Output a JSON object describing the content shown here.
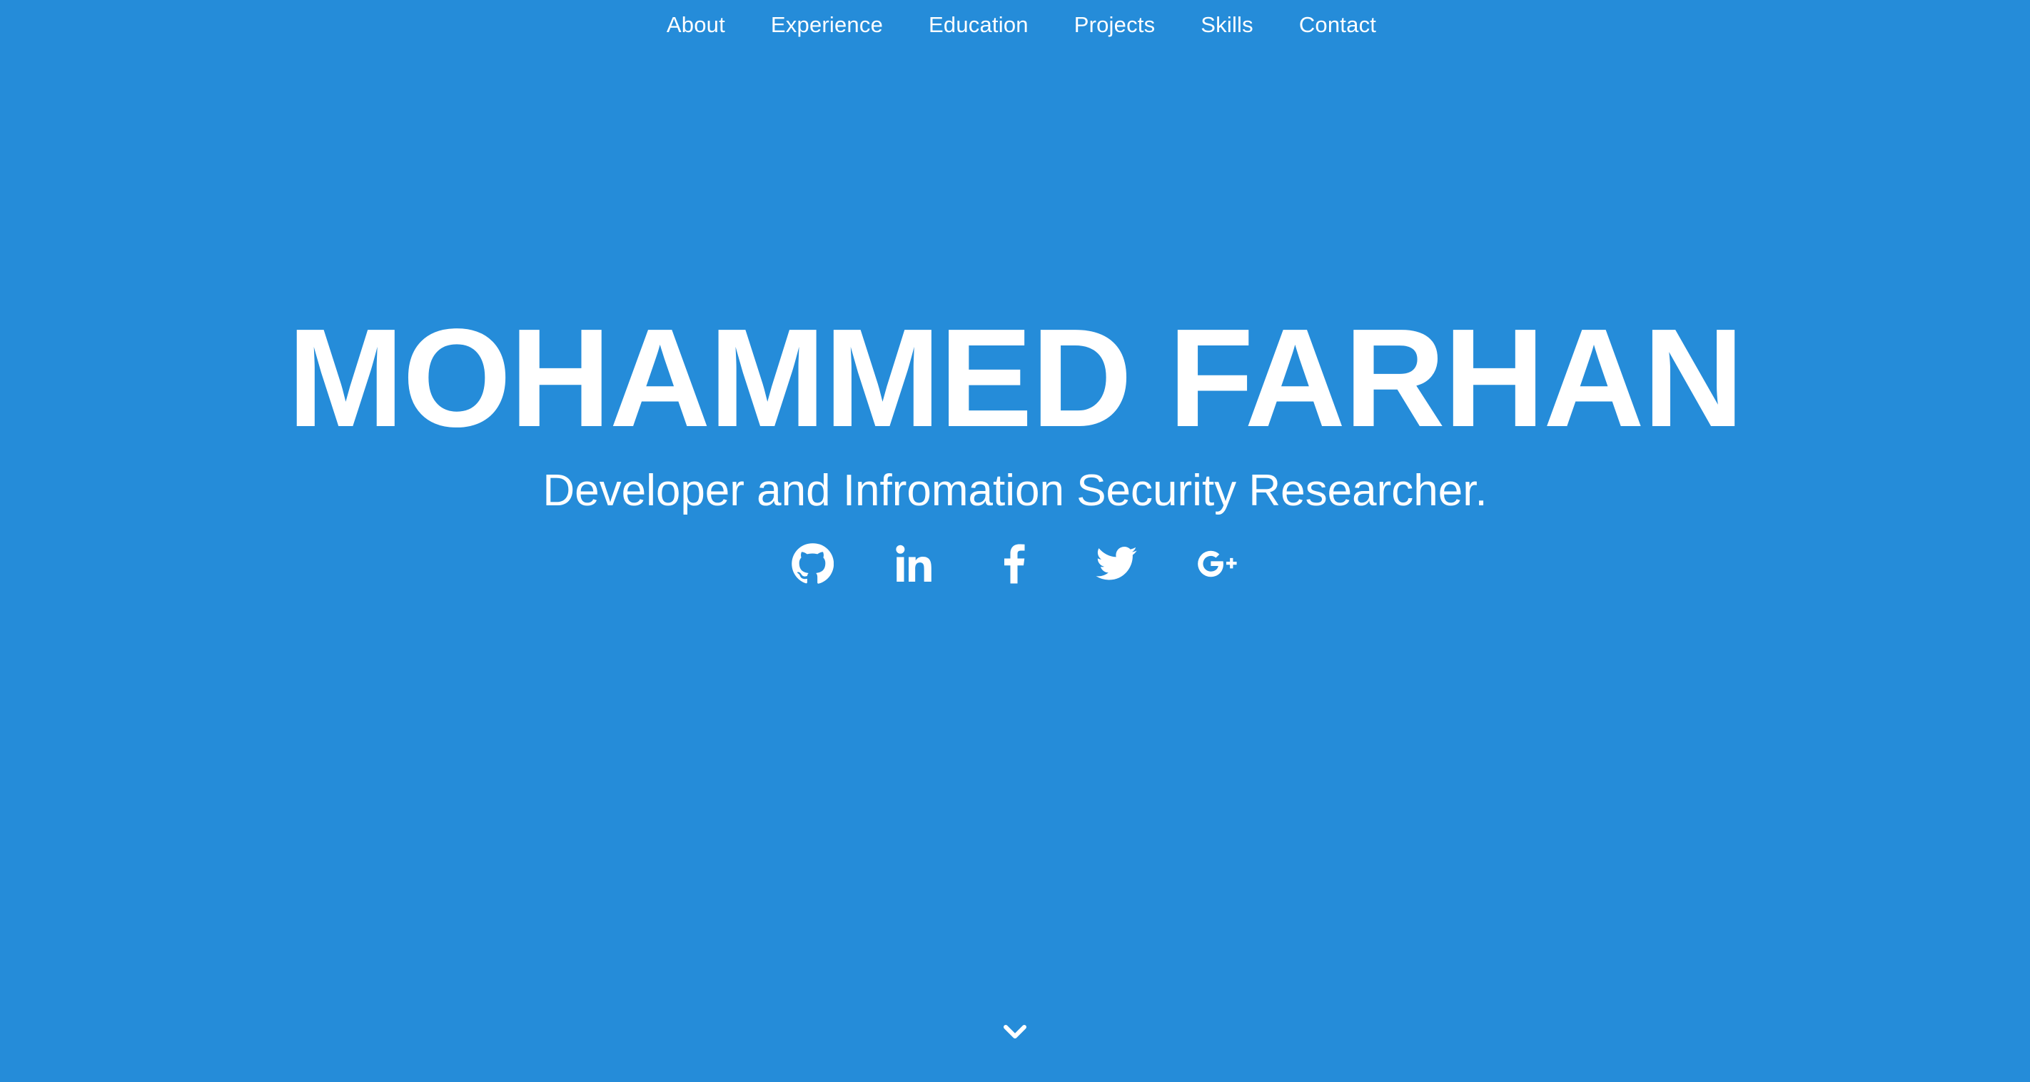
{
  "nav": {
    "items": [
      {
        "label": "About"
      },
      {
        "label": "Experience"
      },
      {
        "label": "Education"
      },
      {
        "label": "Projects"
      },
      {
        "label": "Skills"
      },
      {
        "label": "Contact"
      }
    ]
  },
  "hero": {
    "name": "MOHAMMED FARHAN",
    "subtitle": "Developer and Infromation Security Researcher."
  },
  "socials": [
    {
      "icon": "github-icon"
    },
    {
      "icon": "linkedin-icon"
    },
    {
      "icon": "facebook-icon"
    },
    {
      "icon": "twitter-icon"
    },
    {
      "icon": "google-plus-icon"
    }
  ],
  "scroll": {
    "icon": "chevron-down-icon"
  },
  "colors": {
    "background": "#258cd9",
    "text": "#ffffff"
  }
}
